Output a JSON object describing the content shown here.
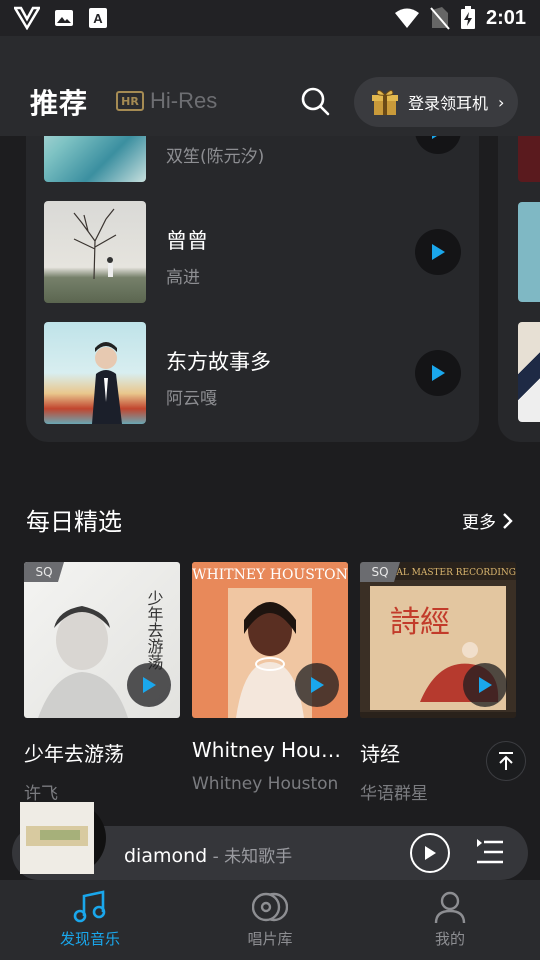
{
  "status_bar": {
    "time": "2:01"
  },
  "header": {
    "title": "推荐",
    "hires_badge": "HR",
    "hires_label": "Hi-Res",
    "login_label": "登录领耳机",
    "login_chevron": "›"
  },
  "recommend_list": [
    {
      "name": "",
      "artist": "双笙(陈元汐)"
    },
    {
      "name": "曾曾",
      "artist": "高进"
    },
    {
      "name": "东方故事多",
      "artist": "阿云嘎"
    }
  ],
  "daily": {
    "title": "每日精选",
    "more_label": "更多",
    "albums": [
      {
        "badge": "SQ",
        "name": "少年去游荡",
        "artist": "许飞"
      },
      {
        "badge": "",
        "name": "Whitney Hous...",
        "artist": "Whitney Houston"
      },
      {
        "badge": "SQ",
        "name": "诗经",
        "artist": "华语群星"
      }
    ]
  },
  "mini_player": {
    "song": "diamond",
    "separator": " - ",
    "artist": "未知歌手"
  },
  "bottom_nav": [
    {
      "label": "发现音乐",
      "active": true
    },
    {
      "label": "唱片库",
      "active": false
    },
    {
      "label": "我的",
      "active": false
    }
  ],
  "colors": {
    "accent": "#1aa7ec",
    "background": "#1d1d1f",
    "card": "#27282b",
    "inactive": "#8d8e92"
  }
}
